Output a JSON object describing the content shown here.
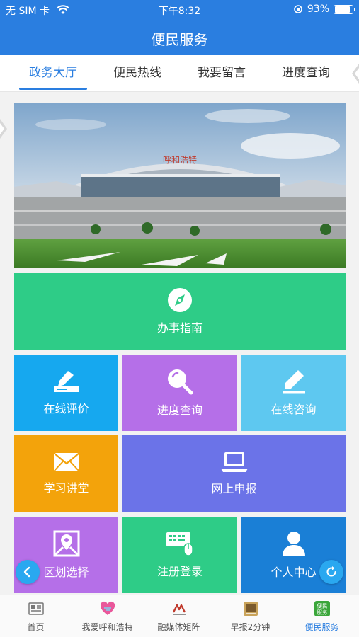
{
  "status": {
    "carrier": "无 SIM 卡",
    "time": "下午8:32",
    "battery": "93%",
    "battery_level": 0.93
  },
  "header": {
    "title": "便民服务"
  },
  "tabs": [
    {
      "label": "政务大厅",
      "active": true
    },
    {
      "label": "便民热线",
      "active": false
    },
    {
      "label": "我要留言",
      "active": false
    },
    {
      "label": "进度查询",
      "active": false
    }
  ],
  "banner": {
    "sign_text": "呼和浩特"
  },
  "tiles": {
    "guide": {
      "label": "办事指南",
      "color": "#2ecc87",
      "icon": "compass-icon"
    },
    "evaluate": {
      "label": "在线评价",
      "color": "#16a8ef",
      "icon": "sign-pen-icon"
    },
    "progress": {
      "label": "进度查询",
      "color": "#b56fe8",
      "icon": "magnifier-icon"
    },
    "consult": {
      "label": "在线咨询",
      "color": "#5ec8f0",
      "icon": "pencil-icon"
    },
    "lecture": {
      "label": "学习讲堂",
      "color": "#f3a30b",
      "icon": "envelope-icon"
    },
    "declare": {
      "label": "网上申报",
      "color": "#6b73e8",
      "icon": "laptop-icon"
    },
    "region": {
      "label": "区划选择",
      "color": "#b56fe8",
      "icon": "map-pin-icon"
    },
    "register": {
      "label": "注册登录",
      "color": "#2ecc87",
      "icon": "keypad-mouse-icon"
    },
    "personal": {
      "label": "个人中心",
      "color": "#1a7fd6",
      "icon": "person-icon"
    }
  },
  "bottom_nav": [
    {
      "label": "首页",
      "icon": "newspaper-icon",
      "active": false
    },
    {
      "label": "我爱呼和浩特",
      "icon": "heart-city-icon",
      "active": false
    },
    {
      "label": "融媒体矩阵",
      "icon": "media-logo-icon",
      "active": false
    },
    {
      "label": "早报2分钟",
      "icon": "news-photo-icon",
      "active": false
    },
    {
      "label": "便民服务",
      "icon": "service-badge-icon",
      "active": true
    }
  ],
  "bottom_nav_badge": "便民服务",
  "fab": {
    "back_icon": "chevron-left-icon",
    "refresh_icon": "refresh-icon"
  }
}
